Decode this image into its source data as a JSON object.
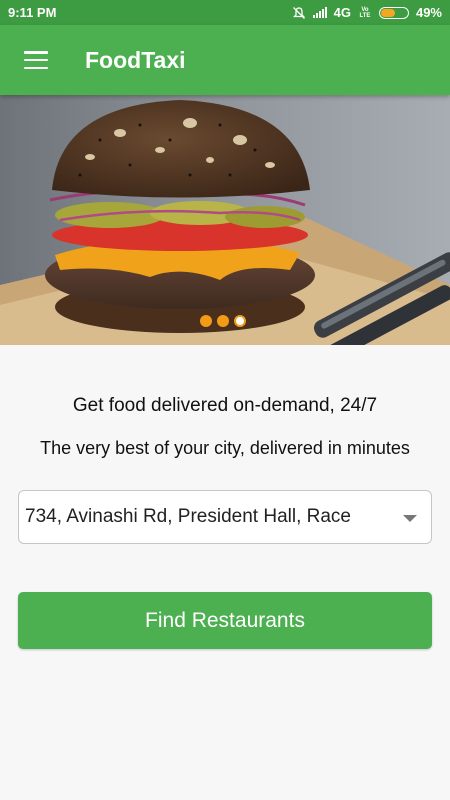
{
  "status_bar": {
    "time": "9:11 PM",
    "network": "4G",
    "volte": "Vo LTE",
    "battery": "49%",
    "battery_level": 0.49,
    "icons": [
      "mute-icon",
      "signal-icon",
      "volte-icon",
      "battery-icon"
    ]
  },
  "app_bar": {
    "title": "FoodTaxi",
    "menu_icon": "hamburger-menu-icon"
  },
  "hero": {
    "image": "burger-photo",
    "carousel_total": 3,
    "carousel_active": 3
  },
  "content": {
    "headline": "Get food delivered on-demand, 24/7",
    "subline": "The very best of your city, delivered in minutes"
  },
  "address_select": {
    "value": "734, Avinashi Rd, President Hall, Race"
  },
  "find_button": {
    "label": "Find Restaurants"
  },
  "colors": {
    "primary": "#4caf50",
    "status_bar": "#3d9b41",
    "accent": "#f39b17"
  }
}
